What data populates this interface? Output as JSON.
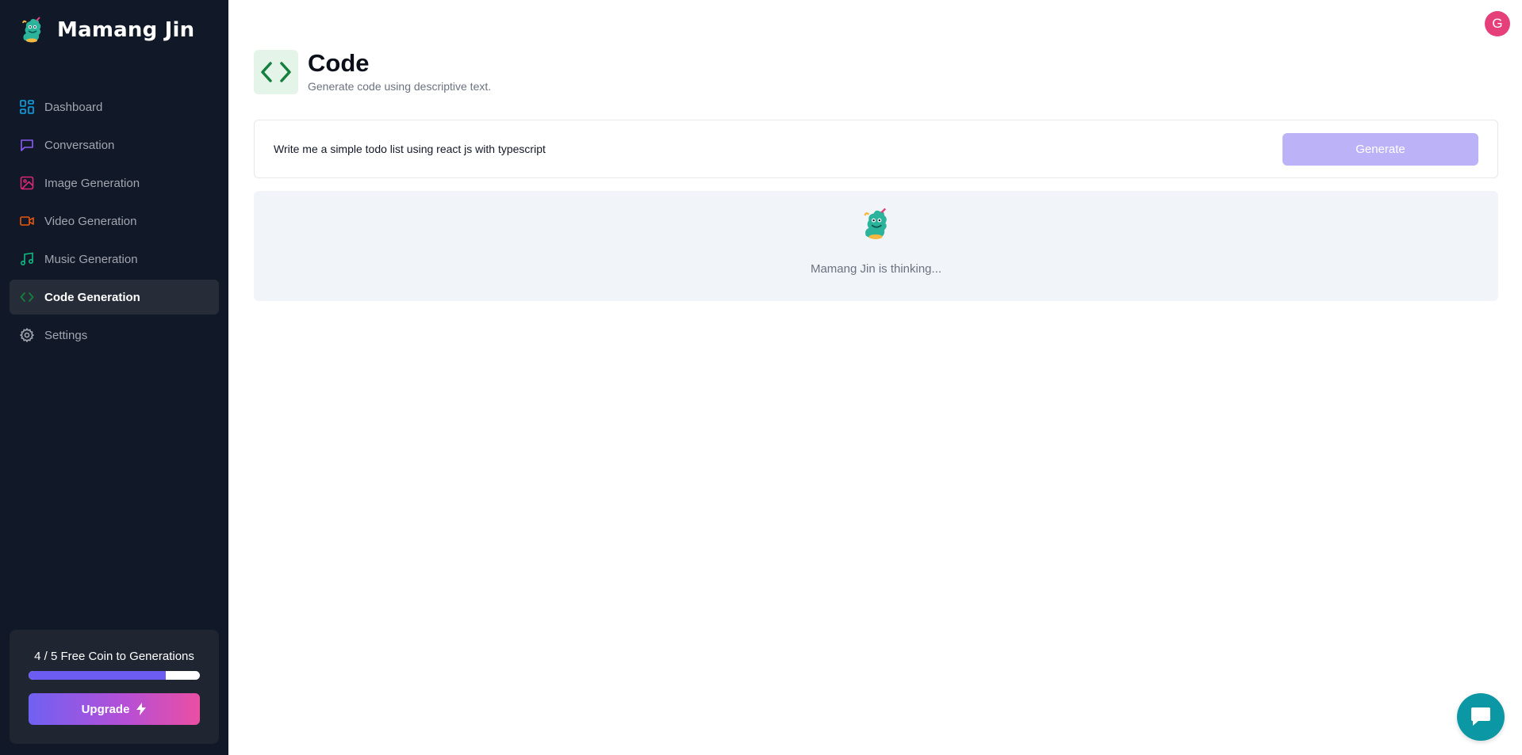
{
  "brand": {
    "name": "Mamang Jin",
    "logo_icon": "genie-mascot-icon"
  },
  "sidebar": {
    "items": [
      {
        "label": "Dashboard",
        "icon": "dashboard-icon",
        "color": "#0ea5e9",
        "active": false
      },
      {
        "label": "Conversation",
        "icon": "chat-bubble-icon",
        "color": "#8b5cf6",
        "active": false
      },
      {
        "label": "Image Generation",
        "icon": "image-icon",
        "color": "#db2777",
        "active": false
      },
      {
        "label": "Video Generation",
        "icon": "video-icon",
        "color": "#ea580c",
        "active": false
      },
      {
        "label": "Music Generation",
        "icon": "music-icon",
        "color": "#10b981",
        "active": false
      },
      {
        "label": "Code Generation",
        "icon": "code-icon",
        "color": "#15803d",
        "active": true
      },
      {
        "label": "Settings",
        "icon": "gear-icon",
        "color": "#a1a6b1",
        "active": false
      }
    ]
  },
  "quota": {
    "text": "4 / 5 Free Coin to Generations",
    "used": 4,
    "total": 5,
    "fraction": 0.8,
    "upgrade_label": "Upgrade",
    "upgrade_icon": "lightning-icon"
  },
  "user": {
    "avatar_initial": "G",
    "avatar_color": "#e5407a"
  },
  "page": {
    "title": "Code",
    "subtitle": "Generate code using descriptive text.",
    "icon": "code-icon",
    "icon_color": "#15803d"
  },
  "prompt": {
    "value": "Write me a simple todo list using react js with typescript",
    "generate_label": "Generate"
  },
  "thinking": {
    "text": "Mamang Jin is thinking..."
  },
  "chat": {
    "icon": "chat-support-icon",
    "color": "#0b98a4"
  }
}
